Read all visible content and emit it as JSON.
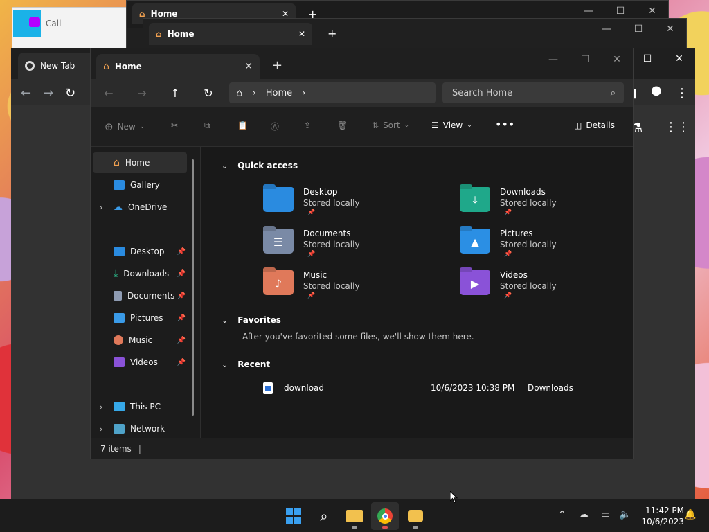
{
  "background_windows": {
    "call_label": "Call",
    "window_a_tab": "Home",
    "window_b_tab": "Home"
  },
  "chrome": {
    "tab_title": "New Tab"
  },
  "explorer": {
    "tab_title": "Home",
    "address": {
      "crumb": "Home"
    },
    "search_placeholder": "Search Home",
    "commands": {
      "new": "New",
      "sort": "Sort",
      "view": "View",
      "details": "Details"
    },
    "sidebar": {
      "top": [
        {
          "label": "Home",
          "selected": true
        },
        {
          "label": "Gallery"
        },
        {
          "label": "OneDrive"
        }
      ],
      "pinned": [
        {
          "label": "Desktop"
        },
        {
          "label": "Downloads"
        },
        {
          "label": "Documents"
        },
        {
          "label": "Pictures"
        },
        {
          "label": "Music"
        },
        {
          "label": "Videos"
        }
      ],
      "bottom": [
        {
          "label": "This PC"
        },
        {
          "label": "Network"
        }
      ]
    },
    "sections": {
      "quick_access": "Quick access",
      "favorites": "Favorites",
      "recent": "Recent"
    },
    "quick_access": [
      {
        "name": "Desktop",
        "sub": "Stored locally",
        "color": "#2a8be0"
      },
      {
        "name": "Downloads",
        "sub": "Stored locally",
        "color": "#1fa88a"
      },
      {
        "name": "Documents",
        "sub": "Stored locally",
        "color": "#7a8aa6"
      },
      {
        "name": "Pictures",
        "sub": "Stored locally",
        "color": "#2b8fe4"
      },
      {
        "name": "Music",
        "sub": "Stored locally",
        "color": "#e0795a"
      },
      {
        "name": "Videos",
        "sub": "Stored locally",
        "color": "#8a52d8"
      }
    ],
    "favorites_message": "After you've favorited some files, we'll show them here.",
    "recent": [
      {
        "name": "download",
        "date": "10/6/2023 10:38 PM",
        "location": "Downloads"
      }
    ],
    "status": "7 items"
  },
  "taskbar": {
    "time": "11:42 PM",
    "date": "10/6/2023"
  }
}
